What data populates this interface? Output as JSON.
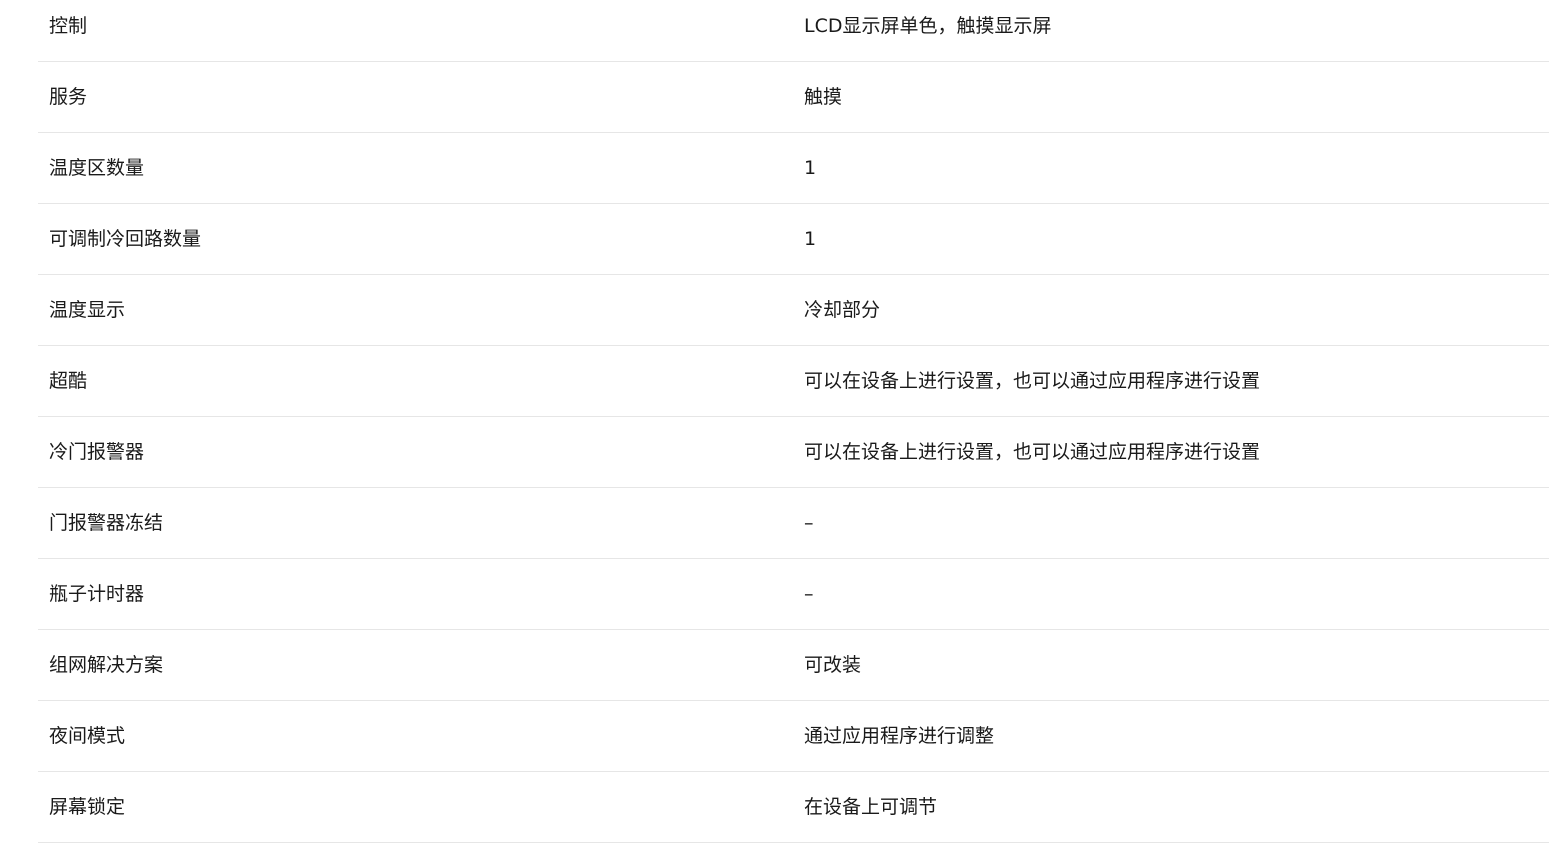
{
  "specs": [
    {
      "label": "控制",
      "value": "LCD显示屏单色，触摸显示屏"
    },
    {
      "label": "服务",
      "value": "触摸"
    },
    {
      "label": "温度区数量",
      "value": "1"
    },
    {
      "label": "可调制冷回路数量",
      "value": "1"
    },
    {
      "label": "温度显示",
      "value": "冷却部分"
    },
    {
      "label": "超酷",
      "value": "可以在设备上进行设置，也可以通过应用程序进行设置"
    },
    {
      "label": "冷门报警器",
      "value": "可以在设备上进行设置，也可以通过应用程序进行设置"
    },
    {
      "label": "门报警器冻结",
      "value": "–"
    },
    {
      "label": "瓶子计时器",
      "value": "–"
    },
    {
      "label": "组网解决方案",
      "value": "可改装"
    },
    {
      "label": "夜间模式",
      "value": "通过应用程序进行调整"
    },
    {
      "label": "屏幕锁定",
      "value": "在设备上可调节"
    }
  ]
}
